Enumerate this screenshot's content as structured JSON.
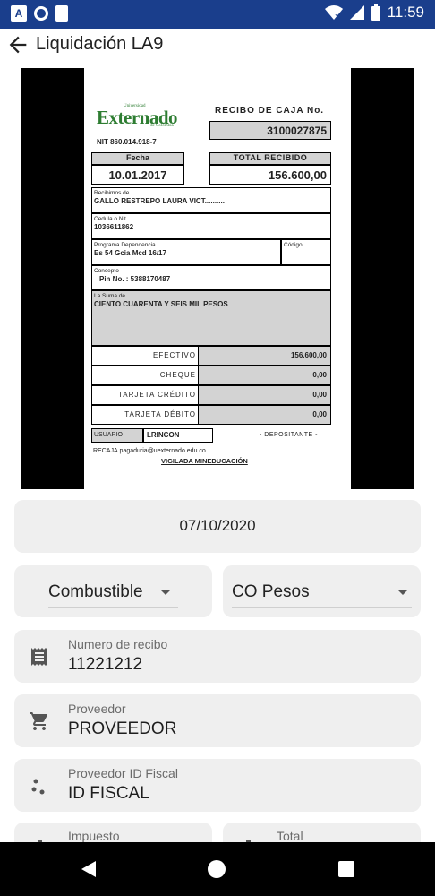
{
  "status_bar": {
    "time": "11:59",
    "notification_icons": [
      "a-notification-icon",
      "circle-notification-icon",
      "sd-card-icon"
    ],
    "system_icons": [
      "wifi-icon",
      "signal-icon",
      "battery-icon"
    ],
    "background_color": "#1a3e8c"
  },
  "app_bar": {
    "title": "Liquidación LA9"
  },
  "receipt": {
    "logo_top": "Universidad",
    "logo": "Externado",
    "logo_sub": "de Colombia",
    "nit": "NIT 860.014.918-7",
    "recibo_label": "RECIBO DE CAJA No.",
    "recibo_no": "3100027875",
    "fecha_label": "Fecha",
    "fecha": "10.01.2017",
    "total_label": "TOTAL RECIBIDO",
    "total": "156.600,00",
    "recibimos_label": "Recibimos de",
    "recibimos": "GALLO RESTREPO LAURA VICT..........",
    "cedula_label": "Cedula o Nit",
    "cedula": "1036611862",
    "programa_label": "Programa Dependencia",
    "programa": "Es 54 Gcia Mcd 16/17",
    "codigo_label": "Código",
    "concepto_label": "Concepto",
    "concepto": "Pin No. : 5388170487",
    "suma_label": "La Suma de",
    "suma": "CIENTO CUARENTA Y SEIS MIL PESOS",
    "payments": [
      {
        "label": "EFECTIVO",
        "value": "156.600,00"
      },
      {
        "label": "CHEQUE",
        "value": "0,00"
      },
      {
        "label": "TARJETA CRÉDITO",
        "value": "0,00"
      },
      {
        "label": "TARJETA DÉBITO",
        "value": "0,00"
      }
    ],
    "usuario_label": "USUARIO",
    "usuario": "LRINCON",
    "depositante": "- DEPOSITANTE -",
    "email": "RECAJA.pagaduria@uexternado.edu.co",
    "vigilada": "VIGILADA MINEDUCACIÓN"
  },
  "form": {
    "date": "07/10/2020",
    "category": "Combustible",
    "currency": "CO Pesos",
    "receipt_number": {
      "label": "Numero de recibo",
      "value": "11221212",
      "icon": "receipt-icon"
    },
    "provider": {
      "label": "Proveedor",
      "value": "PROVEEDOR",
      "icon": "cart-icon"
    },
    "provider_tax_id": {
      "label": "Proveedor ID Fiscal",
      "value": "ID FISCAL",
      "icon": "dots-icon"
    },
    "tax": {
      "label": "Impuesto"
    },
    "total": {
      "label": "Total"
    }
  },
  "nav": {
    "icons": [
      "back-triangle-icon",
      "home-circle-icon",
      "recents-square-icon"
    ]
  }
}
